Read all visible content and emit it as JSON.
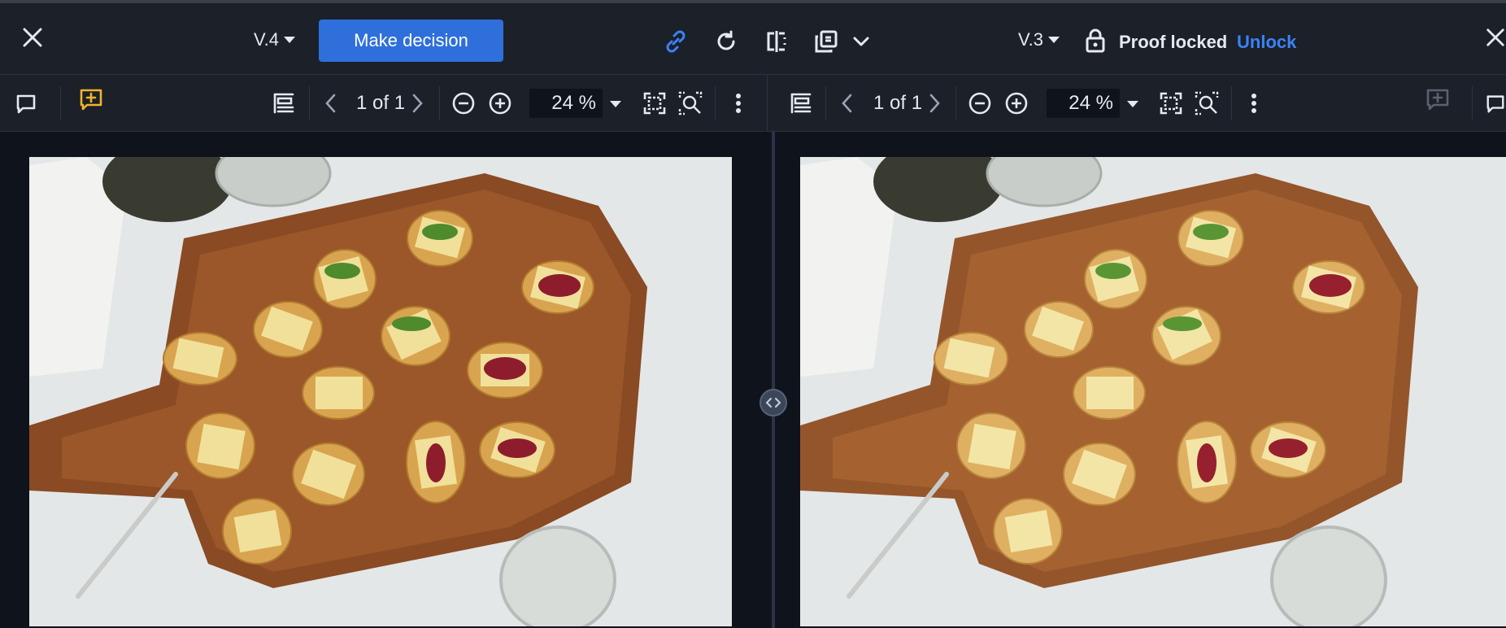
{
  "header": {
    "left_version": "V.4",
    "decision_label": "Make decision",
    "right_version": "V.3",
    "proof_locked_label": "Proof locked",
    "unlock_label": "Unlock"
  },
  "left_toolbar": {
    "page_indicator": "1 of 1",
    "zoom_value": "24 %"
  },
  "right_toolbar": {
    "page_indicator": "1 of 1",
    "zoom_value": "24 %"
  },
  "colors": {
    "accent_blue": "#2f6fdb",
    "link_blue": "#3b82f6",
    "annotation_yellow": "#f0b429",
    "bg_dark": "#1b2029"
  },
  "icons": [
    "close-icon",
    "link-icon",
    "refresh-icon",
    "compare-split-icon",
    "overlay-icon",
    "chevron-down-icon",
    "lock-icon",
    "comment-icon",
    "add-annotation-icon",
    "page-layout-icon",
    "chevron-left-icon",
    "chevron-right-icon",
    "zoom-out-icon",
    "zoom-in-icon",
    "fit-screen-icon",
    "zoom-area-icon",
    "more-vertical-icon"
  ]
}
